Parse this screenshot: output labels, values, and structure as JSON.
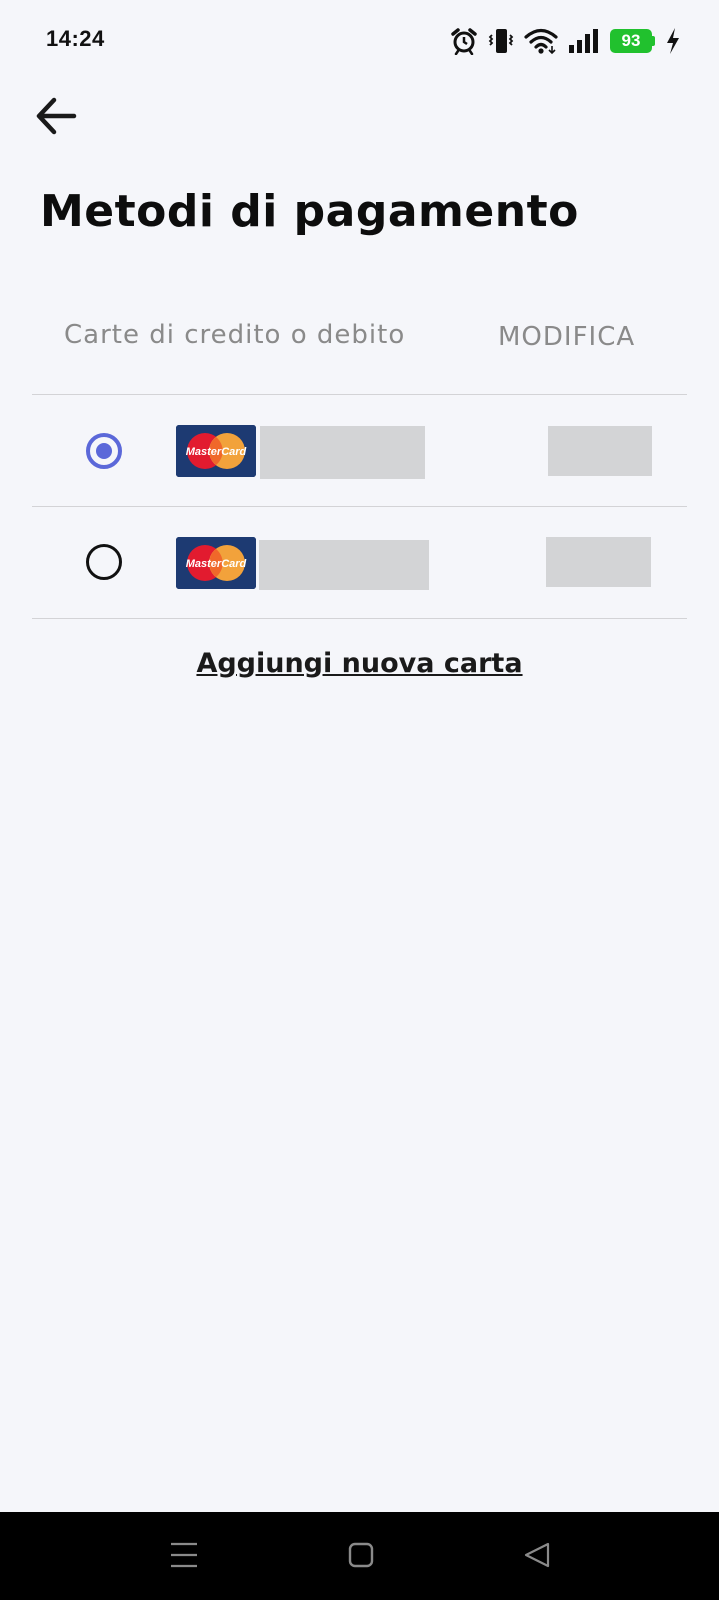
{
  "status_bar": {
    "time": "14:24",
    "battery_level": "93",
    "battery_color": "#21c12e",
    "icons": [
      "alarm-icon",
      "vibrate-icon",
      "wifi-icon",
      "signal-icon",
      "battery-icon",
      "charging-icon"
    ]
  },
  "header": {
    "back_icon": "arrow-left-icon",
    "title": "Metodi di pagamento"
  },
  "section": {
    "label": "Carte di credito o debito",
    "edit_label": "MODIFICA"
  },
  "cards": [
    {
      "brand": "MasterCard",
      "selected": true
    },
    {
      "brand": "MasterCard",
      "selected": false
    }
  ],
  "add_card_label": "Aggiungi nuova carta",
  "colors": {
    "accent": "#5b68d9",
    "card_logo_bg": "#1d3a72",
    "background": "#f5f6fa"
  },
  "nav_bar": {
    "icons": [
      "menu-icon",
      "home-icon",
      "back-triangle-icon"
    ]
  }
}
